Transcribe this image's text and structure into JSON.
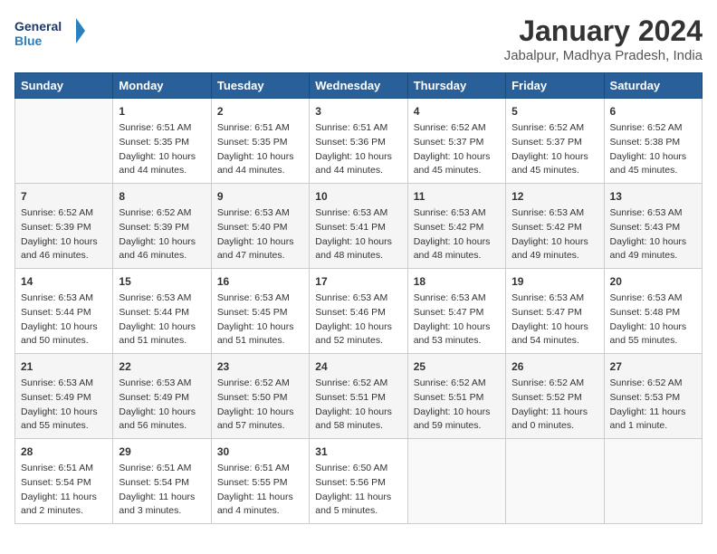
{
  "header": {
    "logo_line1": "General",
    "logo_line2": "Blue",
    "month_title": "January 2024",
    "subtitle": "Jabalpur, Madhya Pradesh, India"
  },
  "weekdays": [
    "Sunday",
    "Monday",
    "Tuesday",
    "Wednesday",
    "Thursday",
    "Friday",
    "Saturday"
  ],
  "weeks": [
    [
      {
        "day": "",
        "data": ""
      },
      {
        "day": "1",
        "data": "Sunrise: 6:51 AM\nSunset: 5:35 PM\nDaylight: 10 hours\nand 44 minutes."
      },
      {
        "day": "2",
        "data": "Sunrise: 6:51 AM\nSunset: 5:35 PM\nDaylight: 10 hours\nand 44 minutes."
      },
      {
        "day": "3",
        "data": "Sunrise: 6:51 AM\nSunset: 5:36 PM\nDaylight: 10 hours\nand 44 minutes."
      },
      {
        "day": "4",
        "data": "Sunrise: 6:52 AM\nSunset: 5:37 PM\nDaylight: 10 hours\nand 45 minutes."
      },
      {
        "day": "5",
        "data": "Sunrise: 6:52 AM\nSunset: 5:37 PM\nDaylight: 10 hours\nand 45 minutes."
      },
      {
        "day": "6",
        "data": "Sunrise: 6:52 AM\nSunset: 5:38 PM\nDaylight: 10 hours\nand 45 minutes."
      }
    ],
    [
      {
        "day": "7",
        "data": "Sunrise: 6:52 AM\nSunset: 5:39 PM\nDaylight: 10 hours\nand 46 minutes."
      },
      {
        "day": "8",
        "data": "Sunrise: 6:52 AM\nSunset: 5:39 PM\nDaylight: 10 hours\nand 46 minutes."
      },
      {
        "day": "9",
        "data": "Sunrise: 6:53 AM\nSunset: 5:40 PM\nDaylight: 10 hours\nand 47 minutes."
      },
      {
        "day": "10",
        "data": "Sunrise: 6:53 AM\nSunset: 5:41 PM\nDaylight: 10 hours\nand 48 minutes."
      },
      {
        "day": "11",
        "data": "Sunrise: 6:53 AM\nSunset: 5:42 PM\nDaylight: 10 hours\nand 48 minutes."
      },
      {
        "day": "12",
        "data": "Sunrise: 6:53 AM\nSunset: 5:42 PM\nDaylight: 10 hours\nand 49 minutes."
      },
      {
        "day": "13",
        "data": "Sunrise: 6:53 AM\nSunset: 5:43 PM\nDaylight: 10 hours\nand 49 minutes."
      }
    ],
    [
      {
        "day": "14",
        "data": "Sunrise: 6:53 AM\nSunset: 5:44 PM\nDaylight: 10 hours\nand 50 minutes."
      },
      {
        "day": "15",
        "data": "Sunrise: 6:53 AM\nSunset: 5:44 PM\nDaylight: 10 hours\nand 51 minutes."
      },
      {
        "day": "16",
        "data": "Sunrise: 6:53 AM\nSunset: 5:45 PM\nDaylight: 10 hours\nand 51 minutes."
      },
      {
        "day": "17",
        "data": "Sunrise: 6:53 AM\nSunset: 5:46 PM\nDaylight: 10 hours\nand 52 minutes."
      },
      {
        "day": "18",
        "data": "Sunrise: 6:53 AM\nSunset: 5:47 PM\nDaylight: 10 hours\nand 53 minutes."
      },
      {
        "day": "19",
        "data": "Sunrise: 6:53 AM\nSunset: 5:47 PM\nDaylight: 10 hours\nand 54 minutes."
      },
      {
        "day": "20",
        "data": "Sunrise: 6:53 AM\nSunset: 5:48 PM\nDaylight: 10 hours\nand 55 minutes."
      }
    ],
    [
      {
        "day": "21",
        "data": "Sunrise: 6:53 AM\nSunset: 5:49 PM\nDaylight: 10 hours\nand 55 minutes."
      },
      {
        "day": "22",
        "data": "Sunrise: 6:53 AM\nSunset: 5:49 PM\nDaylight: 10 hours\nand 56 minutes."
      },
      {
        "day": "23",
        "data": "Sunrise: 6:52 AM\nSunset: 5:50 PM\nDaylight: 10 hours\nand 57 minutes."
      },
      {
        "day": "24",
        "data": "Sunrise: 6:52 AM\nSunset: 5:51 PM\nDaylight: 10 hours\nand 58 minutes."
      },
      {
        "day": "25",
        "data": "Sunrise: 6:52 AM\nSunset: 5:51 PM\nDaylight: 10 hours\nand 59 minutes."
      },
      {
        "day": "26",
        "data": "Sunrise: 6:52 AM\nSunset: 5:52 PM\nDaylight: 11 hours\nand 0 minutes."
      },
      {
        "day": "27",
        "data": "Sunrise: 6:52 AM\nSunset: 5:53 PM\nDaylight: 11 hours\nand 1 minute."
      }
    ],
    [
      {
        "day": "28",
        "data": "Sunrise: 6:51 AM\nSunset: 5:54 PM\nDaylight: 11 hours\nand 2 minutes."
      },
      {
        "day": "29",
        "data": "Sunrise: 6:51 AM\nSunset: 5:54 PM\nDaylight: 11 hours\nand 3 minutes."
      },
      {
        "day": "30",
        "data": "Sunrise: 6:51 AM\nSunset: 5:55 PM\nDaylight: 11 hours\nand 4 minutes."
      },
      {
        "day": "31",
        "data": "Sunrise: 6:50 AM\nSunset: 5:56 PM\nDaylight: 11 hours\nand 5 minutes."
      },
      {
        "day": "",
        "data": ""
      },
      {
        "day": "",
        "data": ""
      },
      {
        "day": "",
        "data": ""
      }
    ]
  ]
}
